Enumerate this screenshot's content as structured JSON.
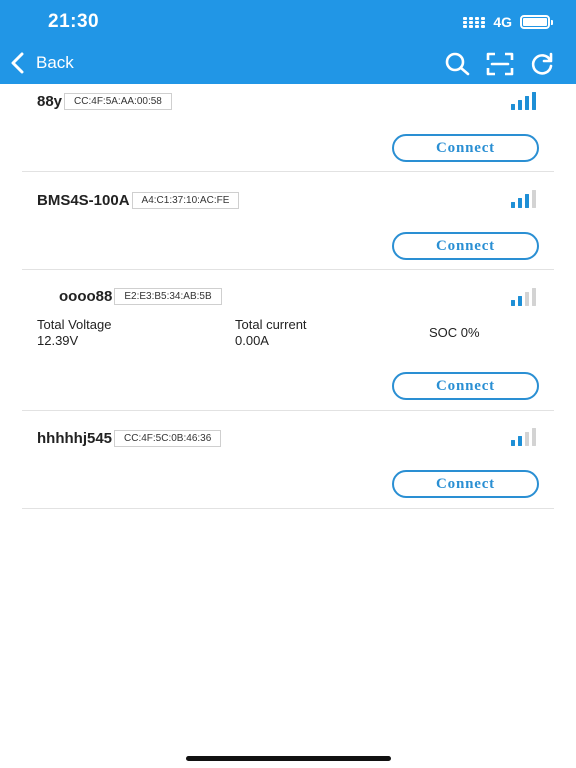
{
  "status_bar": {
    "time": "21:30",
    "network": "4G",
    "battery_level": 1.0
  },
  "nav": {
    "back_label": "Back",
    "icons": [
      "search-icon",
      "scan-icon",
      "refresh-icon"
    ]
  },
  "colors": {
    "header_bg": "#2196E6",
    "accent": "#2a8fd3",
    "signal_active": "#1e8fd6",
    "signal_inactive": "#d3d3d3"
  },
  "devices": [
    {
      "name": "88y",
      "mac": "CC:4F:5A:AA:00:58",
      "signal_bars": 4,
      "connect_label": "Connect"
    },
    {
      "name": "BMS4S-100A",
      "mac": "A4:C1:37:10:AC:FE",
      "signal_bars": 3,
      "connect_label": "Connect"
    },
    {
      "name": "oooo88",
      "mac": "E2:E3:B5:34:AB:5B",
      "signal_bars": 2,
      "connect_label": "Connect",
      "total_voltage_label": "Total Voltage",
      "total_voltage": "12.39V",
      "total_current_label": "Total current",
      "total_current": "0.00A",
      "soc": "SOC 0%"
    },
    {
      "name": "hhhhhj545",
      "mac": "CC:4F:5C:0B:46:36",
      "signal_bars": 2,
      "connect_label": "Connect"
    }
  ]
}
